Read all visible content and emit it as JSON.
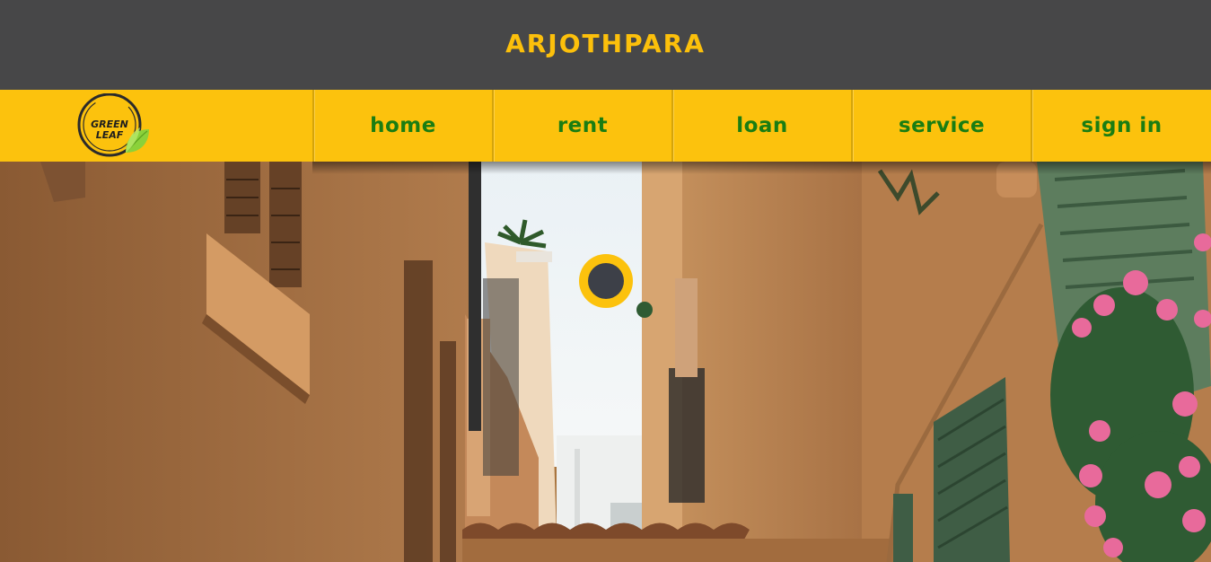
{
  "header": {
    "title": "ARJOTHPARA"
  },
  "logo": {
    "line1": "GREEN",
    "line2": "LEAF",
    "icon": "leaf-icon"
  },
  "nav": {
    "items": [
      {
        "label": "home"
      },
      {
        "label": "rent"
      },
      {
        "label": "loan"
      },
      {
        "label": "service"
      },
      {
        "label": "sign in"
      }
    ]
  },
  "hero": {
    "image": "narrow-alley-photo",
    "loader_icon": "loading-spinner-icon"
  },
  "colors": {
    "header_bg": "#474748",
    "accent_yellow": "#fcc20d",
    "nav_text_green": "#1a7d12"
  }
}
